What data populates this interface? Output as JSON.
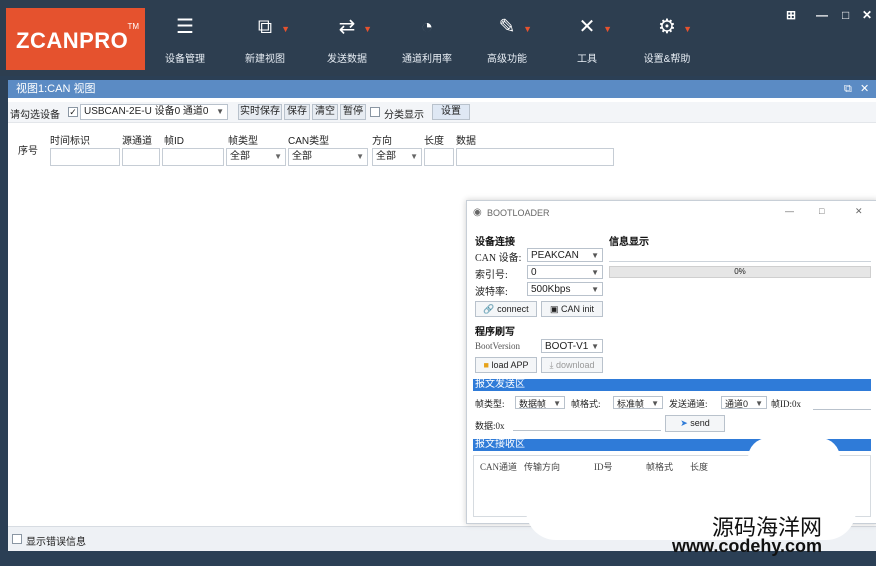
{
  "app": {
    "logo": "ZCANPRO",
    "logo_tm": "TM",
    "toolbar": [
      {
        "label": "设备管理",
        "icon": "device-manager-icon",
        "glyph": "☰",
        "caret": false
      },
      {
        "label": "新建视图",
        "icon": "new-view-icon",
        "glyph": "⧉",
        "caret": true
      },
      {
        "label": "发送数据",
        "icon": "send-data-icon",
        "glyph": "⇄",
        "caret": true
      },
      {
        "label": "通道利用率",
        "icon": "channel-usage-icon",
        "glyph": "◔",
        "caret": false
      },
      {
        "label": "高级功能",
        "icon": "advanced-icon",
        "glyph": "✎",
        "caret": true
      },
      {
        "label": "工具",
        "icon": "tools-icon",
        "glyph": "✕",
        "caret": true
      },
      {
        "label": "设置&帮助",
        "icon": "settings-icon",
        "glyph": "⚙",
        "caret": true
      }
    ],
    "window_controls": [
      "⊞",
      "—",
      "□",
      "✕"
    ]
  },
  "view": {
    "title": "视图1:CAN 视图",
    "ctl_restore": "⧉",
    "ctl_close": "✕",
    "select_device_label": "请勾选设备",
    "device": "USBCAN-2E-U 设备0 通道0",
    "buttons": [
      "实时保存",
      "保存",
      "清空",
      "暂停"
    ],
    "classify_label": "分类显示",
    "settings_button": "设置"
  },
  "table": {
    "seq_header": "序号",
    "columns": [
      "时间标识",
      "源通道",
      "帧ID",
      "帧类型",
      "CAN类型",
      "方向",
      "长度",
      "数据"
    ],
    "filters": {
      "frame_type": "全部",
      "can_type": "全部",
      "direction": "全部"
    }
  },
  "status": {
    "show_errors_label": "显示错误信息"
  },
  "bootloader": {
    "title": "BOOTLOADER",
    "device_section": "设备连接",
    "info_section": "信息显示",
    "can_device_label": "CAN 设备:",
    "can_device": "PEAKCAN",
    "index_label": "索引号:",
    "index": "0",
    "baud_label": "波特率:",
    "baud": "500Kbps",
    "connect": "connect",
    "can_init": "CAN init",
    "progress_text": "0%",
    "progress": 0,
    "flash_section": "程序刷写",
    "boot_version_label": "BootVersion",
    "boot_version": "BOOT-V1",
    "load_app": "load APP",
    "download": "download",
    "send_area": "报文发送区",
    "frame_type_label": "帧类型:",
    "frame_type": "数据帧",
    "frame_format_label": "帧格式:",
    "frame_format": "标准帧",
    "send_channel_label": "发送通道:",
    "send_channel": "通道0",
    "frame_id_label": "帧ID:0x",
    "data_label": "数据:0x",
    "send": "send",
    "recv_area": "报文接收区",
    "recv_columns": [
      "CAN通道",
      "传输方向",
      "ID号",
      "帧格式",
      "长度"
    ]
  },
  "watermark": {
    "line1": "源码海洋网",
    "line2": "www.codehy.com"
  }
}
